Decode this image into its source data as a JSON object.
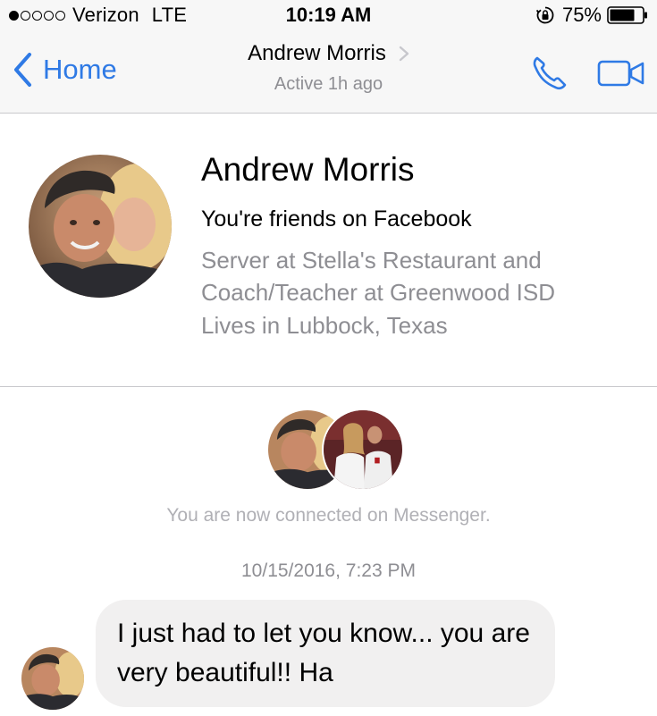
{
  "status_bar": {
    "carrier": "Verizon",
    "network": "LTE",
    "time": "10:19 AM",
    "battery": "75%",
    "signal_bars_filled": 1,
    "signal_bars_total": 5
  },
  "nav": {
    "back_label": "Home",
    "title": "Andrew Morris",
    "subtitle": "Active 1h ago",
    "accent_color": "#2f7ae5",
    "icons": [
      "chevron-left-icon",
      "chevron-right-icon",
      "phone-icon",
      "video-camera-icon"
    ]
  },
  "profile": {
    "name": "Andrew Morris",
    "friends_text": "You're friends on Facebook",
    "work": "Server at Stella's Restaurant and Coach/Teacher at Greenwood ISD",
    "lives": "Lives in Lubbock, Texas"
  },
  "thread": {
    "connected_text": "You are now connected on Messenger.",
    "timestamp": "10/15/2016, 7:23 PM",
    "messages": [
      {
        "text": "I just had to let you know... you are very beautiful!! Ha"
      }
    ],
    "bubble_color": "#f1f0f0"
  }
}
